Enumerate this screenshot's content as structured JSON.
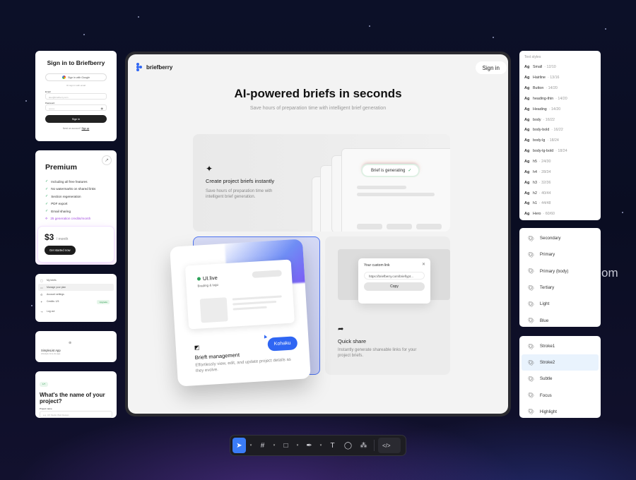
{
  "signin": {
    "title": "Sign in to Briefberry",
    "google": "Sign in with Google",
    "or": "Or sign in with email",
    "email_label": "Email",
    "email_value": "alex@briefberry.com",
    "password_label": "Password",
    "password_value": "••••••••",
    "submit": "Sign in",
    "footer_text": "Need an account?",
    "footer_link": "Sign up"
  },
  "premium": {
    "title": "Premium",
    "features": [
      "Including all free features",
      "No watermarks on shared links",
      "Section regeneration",
      "PDF export",
      "Email sharing"
    ],
    "credits": "25 generation credits/month",
    "price": "$3",
    "period": "/ month",
    "cta": "Get started now"
  },
  "menu": {
    "items": [
      "My briefs",
      "Manage your plan",
      "Account settings",
      "Credits: 1/5",
      "Log out"
    ],
    "upgrade": "Upgrade"
  },
  "appcard": {
    "name": "SimpleList App",
    "sub": "Lifestyle & to-do app"
  },
  "question": {
    "step": "1/7",
    "title": "What's the name of your project?",
    "label": "Project name",
    "placeholder": "e.g. UX Studio Web Design"
  },
  "window": {
    "brand": "briefberry",
    "signin": "Sign in",
    "hero_title": "AI-powered briefs in seconds",
    "hero_sub": "Save hours of preparation time with intelligent brief generation",
    "f1_title": "Create project briefs instantly",
    "f1_desc": "Save hours of preparation time with intelligent brief generation.",
    "generating": "Brief is generating",
    "f2_title": "Brieft management",
    "f2_desc": "Effortlessly view, edit, and update project details as they evolve.",
    "f2_brand": "UI.live",
    "f2_sub": "Brading & logo",
    "f2_user": "Kohaku",
    "f3_title": "Quick share",
    "f3_desc": "Instantly generate shareable links for your project briefs.",
    "modal_title": "Your custom link",
    "modal_url": "https://briefberry.com/brief/ypt...",
    "modal_copy": "Copy"
  },
  "textstyles": {
    "header": "Text styles",
    "items": [
      {
        "name": "Small",
        "size": "12/10"
      },
      {
        "name": "Hairline",
        "size": "13/16"
      },
      {
        "name": "Button",
        "size": "14/20"
      },
      {
        "name": "heading-thin",
        "size": "14/20"
      },
      {
        "name": "Heading",
        "size": "14/20"
      },
      {
        "name": "body",
        "size": "16/22"
      },
      {
        "name": "body-bold",
        "size": "16/22"
      },
      {
        "name": "body-lg",
        "size": "18/24"
      },
      {
        "name": "body-lg-bold",
        "size": "18/24"
      },
      {
        "name": "h5",
        "size": "24/30"
      },
      {
        "name": "h4",
        "size": "28/34"
      },
      {
        "name": "h3",
        "size": "32/36"
      },
      {
        "name": "h2",
        "size": "40/44"
      },
      {
        "name": "h1",
        "size": "44/48"
      },
      {
        "name": "Hero",
        "size": "60/60"
      }
    ]
  },
  "colors1": [
    "Secondary",
    "Primary",
    "Primary (body)",
    "Tertiary",
    "Light",
    "Blue"
  ],
  "colors2": [
    "Stroke1",
    "Stroke2",
    "Subtle",
    "Focus",
    "Highlight"
  ],
  "partial_text": "om",
  "accent": "#2f66f3",
  "toolbar": {
    "tools": [
      "move-tool",
      "frame-tool",
      "rectangle-tool",
      "pen-tool",
      "text-tool",
      "comment-tool",
      "components-tool",
      "code-tool"
    ],
    "active": "move-tool"
  }
}
